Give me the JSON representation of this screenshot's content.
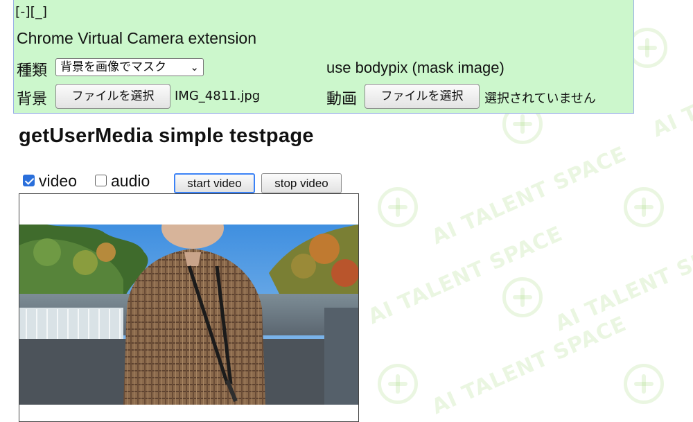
{
  "extension_panel": {
    "collapse_toggle": "[-][_]",
    "title": "Chrome Virtual Camera extension",
    "type_label": "種類",
    "type_select_value": "背景を画像でマスク",
    "mode_info": "use bodypix (mask image)",
    "background_label": "背景",
    "background_file_button": "ファイルを選択",
    "background_file_name": "IMG_4811.jpg",
    "video_label": "動画",
    "video_file_button": "ファイルを選択",
    "video_file_name": "選択されていません"
  },
  "page": {
    "title": "getUserMedia simple testpage",
    "video_checkbox": {
      "label": "video",
      "checked": true
    },
    "audio_checkbox": {
      "label": "audio",
      "checked": false
    },
    "start_button": "start video",
    "stop_button": "stop video"
  },
  "watermark": {
    "text": "AI TALENT SPACE"
  },
  "colors": {
    "panel_background": "#ccf7cc",
    "panel_border": "#9ab0e6",
    "checkbox_accent": "#2a6fdb",
    "focus_ring": "#3b82f6"
  }
}
